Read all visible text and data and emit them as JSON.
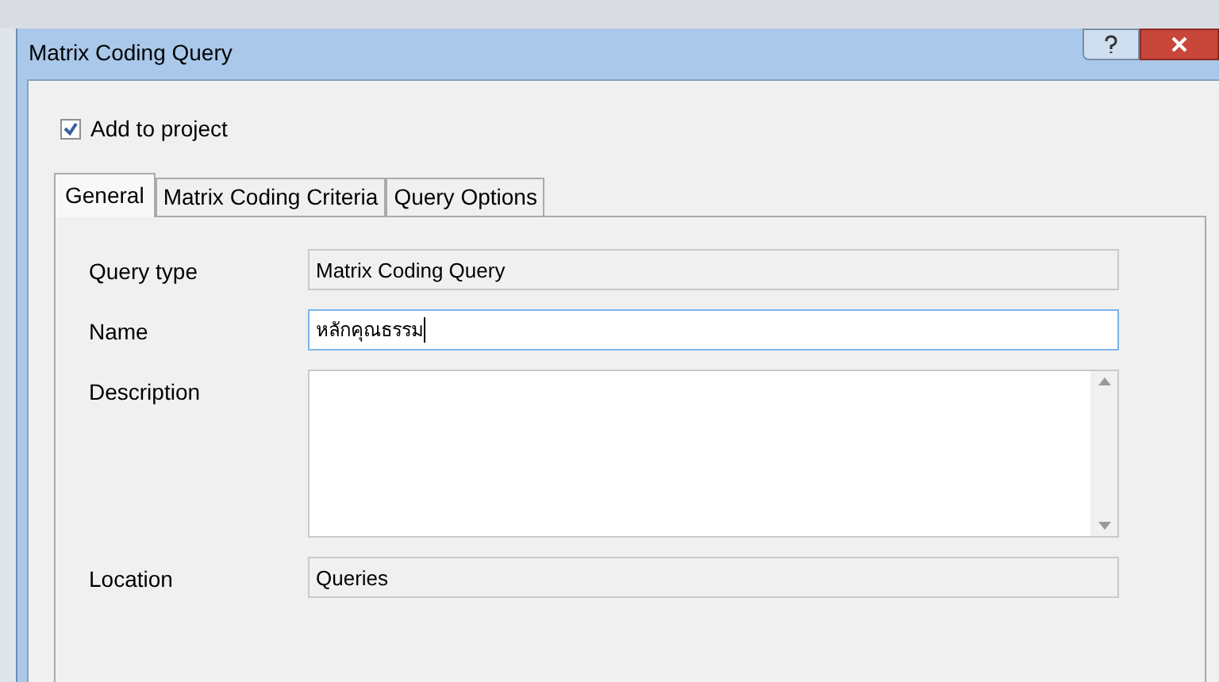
{
  "window": {
    "title": "Matrix Coding Query"
  },
  "add_to_project": {
    "label": "Add to project",
    "checked": true
  },
  "tabs": [
    {
      "label": "General",
      "selected": true
    },
    {
      "label": "Matrix Coding Criteria",
      "selected": false
    },
    {
      "label": "Query Options",
      "selected": false
    }
  ],
  "fields": [
    {
      "label": "Query type",
      "kind": "readonly",
      "value": "Matrix Coding Query"
    },
    {
      "label": "Name",
      "kind": "text",
      "value": "หลักคุณธรรม"
    },
    {
      "label": "Description",
      "kind": "textarea"
    },
    {
      "label": "Location",
      "kind": "readonly",
      "value": "Queries"
    }
  ]
}
